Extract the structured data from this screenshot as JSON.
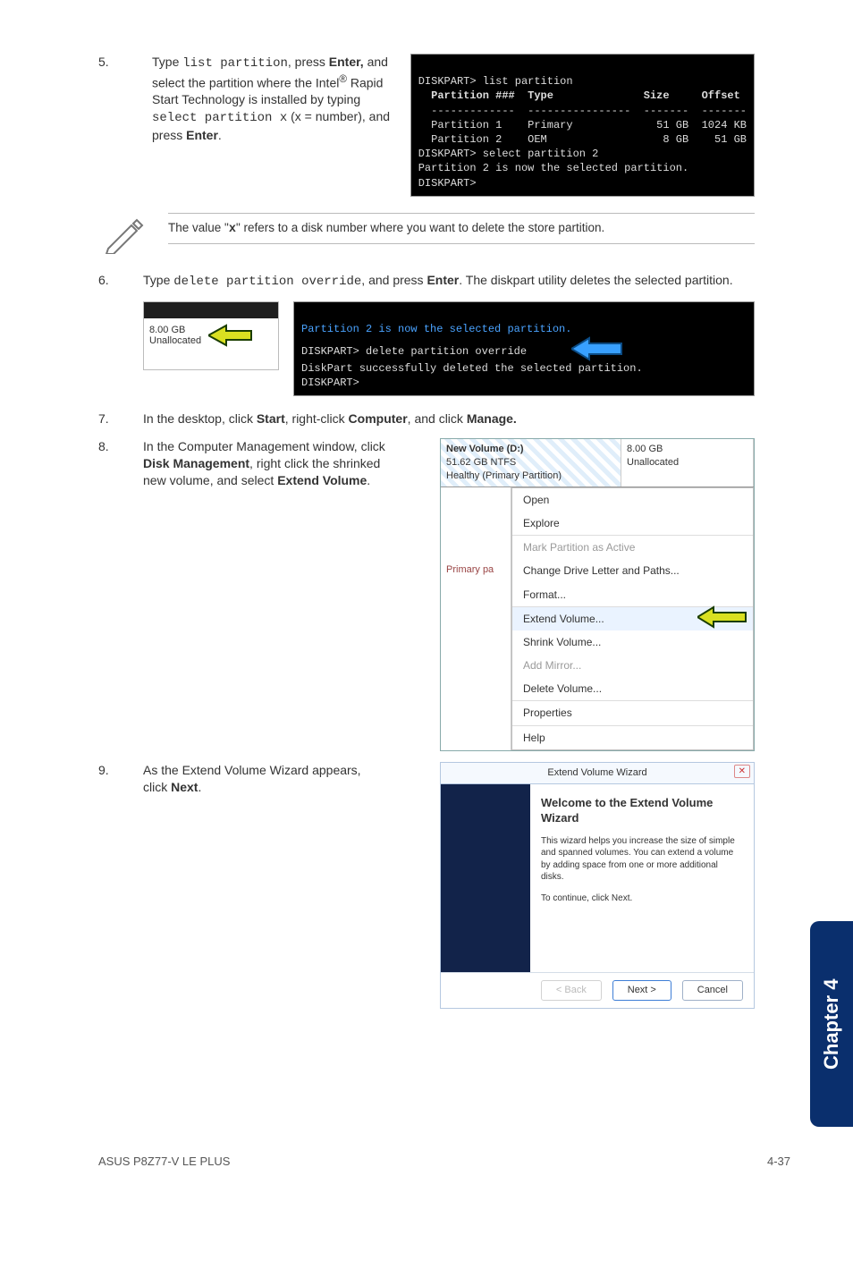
{
  "steps": {
    "s5": {
      "num": "5.",
      "text_pre": "Type ",
      "cmd": "list partition",
      "text_mid": ", press ",
      "enter": "Enter,",
      "text_mid2": " and select the partition where the Intel",
      "reg": "®",
      "text_mid3": " Rapid Start Technology is installed by typing ",
      "cmd2": "select partition x",
      "paren": "(x = number), and press ",
      "enter2": "Enter",
      "dot": "."
    },
    "s6": {
      "num": "6.",
      "text": "Type ",
      "cmd": "delete partition override",
      "mid": ", and press ",
      "enter": "Enter",
      "tail": ". The diskpart utility deletes the selected partition."
    },
    "s7": {
      "num": "7.",
      "text": "In the desktop, click ",
      "b1": "Start",
      "mid1": ", right-click ",
      "b2": "Computer",
      "mid2": ", and click ",
      "b3": "Manage."
    },
    "s8": {
      "num": "8.",
      "l1": "In the Computer Management window, click ",
      "b1": "Disk Management",
      "l2": ", right click the shrinked new volume, and select ",
      "b2": "Extend Volume",
      "dot": "."
    },
    "s9": {
      "num": "9.",
      "text": "As the Extend Volume Wizard appears, click ",
      "b": "Next",
      "dot": "."
    }
  },
  "note": {
    "text_a": "The value \"",
    "x": "x",
    "text_b": "\" refers to a disk number where you want to delete the store partition."
  },
  "term1": {
    "l1": "DISKPART> list partition",
    "h1": "  Partition ###  Type              Size     Offset",
    "h2": "  -------------  ----------------  -------  -------",
    "r1": "  Partition 1    Primary             51 GB  1024 KB",
    "r2": "  Partition 2    OEM                  8 GB    51 GB",
    "l2": "DISKPART> select partition 2",
    "l3": "Partition 2 is now the selected partition.",
    "l4": "DISKPART>"
  },
  "term2": {
    "l1": "Partition 2 is now the selected partition.",
    "l2": "DISKPART> delete partition override",
    "l3": "DiskPart successfully deleted the selected partition.",
    "l4": "DISKPART>"
  },
  "disk_small": {
    "size": "8.00 GB",
    "state": "Unallocated"
  },
  "vol_panel": {
    "title": "New Volume (D:)",
    "sub": "51.62 GB NTFS",
    "state": "Healthy (Primary Partition)",
    "right_size": "8.00 GB",
    "right_state": "Unallocated",
    "side": "Primary pa",
    "menu": {
      "open": "Open",
      "explore": "Explore",
      "mark": "Mark Partition as Active",
      "change": "Change Drive Letter and Paths...",
      "format": "Format...",
      "extend": "Extend Volume...",
      "shrink": "Shrink Volume...",
      "mirror": "Add Mirror...",
      "delete": "Delete Volume...",
      "props": "Properties",
      "help": "Help"
    }
  },
  "wizard": {
    "frame": "Extend Volume Wizard",
    "heading": "Welcome to the Extend Volume Wizard",
    "p1": "This wizard helps you increase the size of simple and spanned volumes. You can extend a volume by adding space from one or more additional disks.",
    "p2": "To continue, click Next.",
    "back": "< Back",
    "next": "Next >",
    "cancel": "Cancel",
    "close": "✕"
  },
  "chapter": "Chapter 4",
  "footer": {
    "left": "ASUS P8Z77-V LE PLUS",
    "right": "4-37"
  }
}
